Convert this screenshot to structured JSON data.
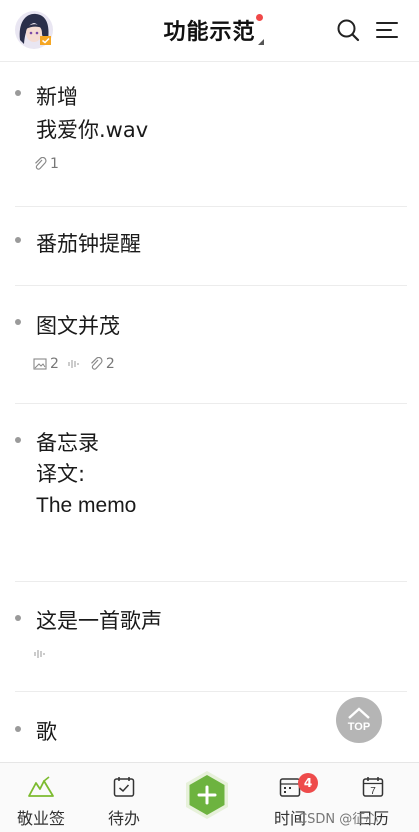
{
  "header": {
    "title": "功能示范",
    "avatar_icon": "avatar-girl-icon",
    "search_icon": "search-icon",
    "menu_icon": "menu-lines-icon"
  },
  "notes": [
    {
      "lines": [
        "新增",
        "我爱你.wav"
      ],
      "attachments": {
        "clip": "1"
      }
    },
    {
      "lines": [
        "番茄钟提醒"
      ]
    },
    {
      "lines": [
        "图文并茂"
      ],
      "attachments": {
        "image": "2",
        "audio": "",
        "clip": "2"
      }
    },
    {
      "lines": [
        "备忘录",
        "",
        "译文:",
        "The memo"
      ]
    },
    {
      "lines": [
        "这是一首歌声"
      ],
      "attachments": {
        "audio": ""
      }
    },
    {
      "lines": [
        "歌"
      ]
    }
  ],
  "top_button": {
    "label": "TOP"
  },
  "bottom_nav": {
    "items": [
      {
        "label": "敬业签",
        "icon": "mountain-logo-icon"
      },
      {
        "label": "待办",
        "icon": "todo-calendar-icon"
      },
      {
        "label": "时间",
        "icon": "time-calendar-icon",
        "badge": "4"
      },
      {
        "label": "日历",
        "icon": "calendar-icon",
        "day": "7"
      }
    ],
    "add_icon": "plus-hexagon-icon"
  },
  "watermark": "CSDN @征心",
  "colors": {
    "accent_green": "#7cbb2f",
    "add_button": "#6db33f",
    "badge": "#ee4b4b",
    "top_button": "#b5b5b5"
  }
}
